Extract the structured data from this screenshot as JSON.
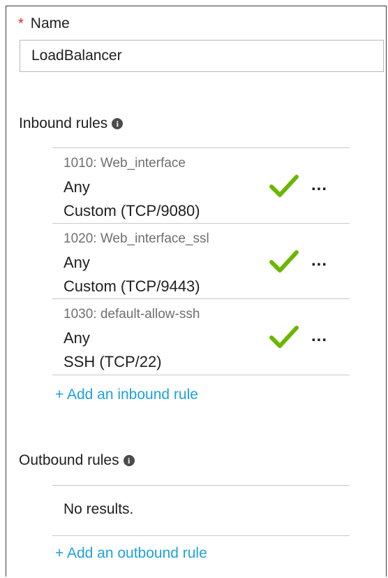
{
  "name_field": {
    "required_mark": "*",
    "label": "Name",
    "value": "LoadBalancer"
  },
  "inbound": {
    "title": "Inbound rules",
    "info_icon": "i",
    "rules": [
      {
        "name": "1010: Web_interface",
        "source": "Any",
        "service": "Custom (TCP/9080)",
        "status_icon": "check-icon",
        "more": "..."
      },
      {
        "name": "1020: Web_interface_ssl",
        "source": "Any",
        "service": "Custom (TCP/9443)",
        "status_icon": "check-icon",
        "more": "..."
      },
      {
        "name": "1030: default-allow-ssh",
        "source": "Any",
        "service": "SSH (TCP/22)",
        "status_icon": "check-icon",
        "more": "..."
      }
    ],
    "add_link": "+ Add an inbound rule"
  },
  "outbound": {
    "title": "Outbound rules",
    "info_icon": "i",
    "empty_text": "No results.",
    "add_link": "+ Add an outbound rule"
  },
  "colors": {
    "accent": "#1ea1de",
    "check": "#6bb700",
    "required": "#e0241a"
  }
}
